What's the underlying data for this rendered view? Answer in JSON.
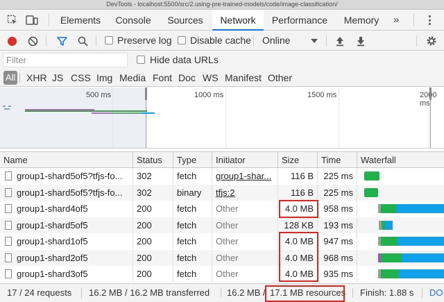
{
  "window": {
    "title": "DevTools - localhost:5500/src/2.using-pre-trained-models/code/image-classification/"
  },
  "tabs": [
    {
      "label": "Elements"
    },
    {
      "label": "Console"
    },
    {
      "label": "Sources"
    },
    {
      "label": "Network",
      "active": true
    },
    {
      "label": "Performance"
    },
    {
      "label": "Memory"
    }
  ],
  "tabs_more": "»",
  "toolbar": {
    "preserve_log": "Preserve log",
    "disable_cache": "Disable cache",
    "throttling": "Online"
  },
  "filter": {
    "placeholder": "Filter",
    "hide_data_urls": "Hide data URLs"
  },
  "types": [
    "All",
    "XHR",
    "JS",
    "CSS",
    "Img",
    "Media",
    "Font",
    "Doc",
    "WS",
    "Manifest",
    "Other"
  ],
  "overview": {
    "ticks": [
      "500 ms",
      "1000 ms",
      "1500 ms",
      "2000 ms"
    ]
  },
  "columns": [
    "Name",
    "Status",
    "Type",
    "Initiator",
    "Size",
    "Time",
    "Waterfall"
  ],
  "rows": [
    {
      "name": "group1-shard5of5?tfjs-fo...",
      "status": "302",
      "type": "fetch",
      "initiator": "group1-shar...",
      "initiator_link": true,
      "size": "116 B",
      "time": "225 ms"
    },
    {
      "name": "group1-shard5of5?tfjs-fo...",
      "status": "302",
      "type": "binary",
      "initiator": "tfjs:2",
      "initiator_link": true,
      "size": "116 B",
      "time": "225 ms"
    },
    {
      "name": "group1-shard4of5",
      "status": "200",
      "type": "fetch",
      "initiator": "Other",
      "initiator_link": false,
      "size": "4.0 MB",
      "time": "958 ms"
    },
    {
      "name": "group1-shard5of5",
      "status": "200",
      "type": "fetch",
      "initiator": "Other",
      "initiator_link": false,
      "size": "128 KB",
      "time": "193 ms"
    },
    {
      "name": "group1-shard1of5",
      "status": "200",
      "type": "fetch",
      "initiator": "Other",
      "initiator_link": false,
      "size": "4.0 MB",
      "time": "947 ms"
    },
    {
      "name": "group1-shard2of5",
      "status": "200",
      "type": "fetch",
      "initiator": "Other",
      "initiator_link": false,
      "size": "4.0 MB",
      "time": "968 ms"
    },
    {
      "name": "group1-shard3of5",
      "status": "200",
      "type": "fetch",
      "initiator": "Other",
      "initiator_link": false,
      "size": "4.0 MB",
      "time": "935 ms"
    }
  ],
  "status_bar": {
    "requests": "17 / 24 requests",
    "transferred": "16.2 MB / 16.2 MB transferred",
    "resources_prefix": "16.2 MB /",
    "resources": "17.1 MB resources",
    "finish": "Finish: 1.88 s",
    "dom": "DO"
  },
  "colors": {
    "accent": "#1a73e8",
    "record": "#d93025",
    "waiting": "#1fb24a",
    "download": "#10a1eb",
    "highlight": "#e2231a"
  }
}
